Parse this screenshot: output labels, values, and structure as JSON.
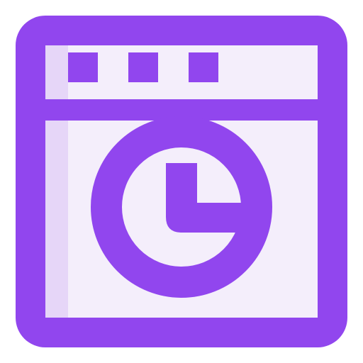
{
  "icon": {
    "name": "browser-window-pie-chart-icon",
    "colors": {
      "outline": "#9146EE",
      "fill_light": "#F4EEFB",
      "fill_shade": "#E6D6F8"
    },
    "parts": {
      "window": "browser-window-icon",
      "dots": [
        "window-dot-icon",
        "window-dot-icon",
        "window-dot-icon"
      ],
      "chart": "pie-chart-icon"
    }
  }
}
